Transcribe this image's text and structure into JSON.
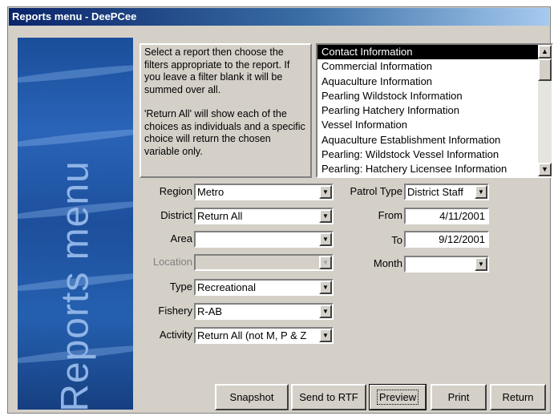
{
  "window": {
    "title": "Reports menu - DeePCee"
  },
  "side_panel": {
    "title": "Reports menu"
  },
  "instructions": {
    "paragraph1": "Select a report then choose the filters appropriate to the report. If you leave a filter blank it will be summed over all.",
    "paragraph2": "'Return All' will show each of the choices as individuals and a specific choice will return the chosen variable only."
  },
  "reports_list": {
    "items": [
      "Contact Information",
      "Commercial Information",
      "Aquaculture Information",
      "Pearling Wildstock Information",
      "Pearling Hatchery Information",
      "Vessel Information",
      "Aquaculture Establishment Information",
      "Pearling: Wildstock Vessel Information",
      "Pearling: Hatchery Licensee Information"
    ],
    "selected_index": 0
  },
  "filters": {
    "region": {
      "label": "Region",
      "value": "Metro"
    },
    "district": {
      "label": "District",
      "value": "Return All"
    },
    "area": {
      "label": "Area",
      "value": ""
    },
    "location": {
      "label": "Location",
      "value": ""
    },
    "type": {
      "label": "Type",
      "value": "Recreational"
    },
    "fishery": {
      "label": "Fishery",
      "value": "R-AB"
    },
    "activity": {
      "label": "Activity",
      "value": "Return All (not M, P & Z"
    },
    "patrol_type": {
      "label": "Patrol Type",
      "value": "District Staff"
    },
    "from": {
      "label": "From",
      "value": "4/11/2001"
    },
    "to": {
      "label": "To",
      "value": "9/12/2001"
    },
    "month": {
      "label": "Month",
      "value": ""
    }
  },
  "buttons": {
    "snapshot": "Snapshot",
    "send_to_rtf": "Send to RTF",
    "preview": "Preview",
    "print": "Print",
    "return": "Return"
  },
  "icons": {
    "scroll_up": "scroll-up-arrow-icon",
    "scroll_down": "scroll-down-arrow-icon",
    "dropdown": "dropdown-arrow-icon"
  },
  "colors": {
    "titlebar_start": "#0a246a",
    "titlebar_end": "#a6caf0",
    "side_panel": "#1d4f9c",
    "side_title": "#8fb4e6",
    "window_face": "#d4d0c8"
  }
}
